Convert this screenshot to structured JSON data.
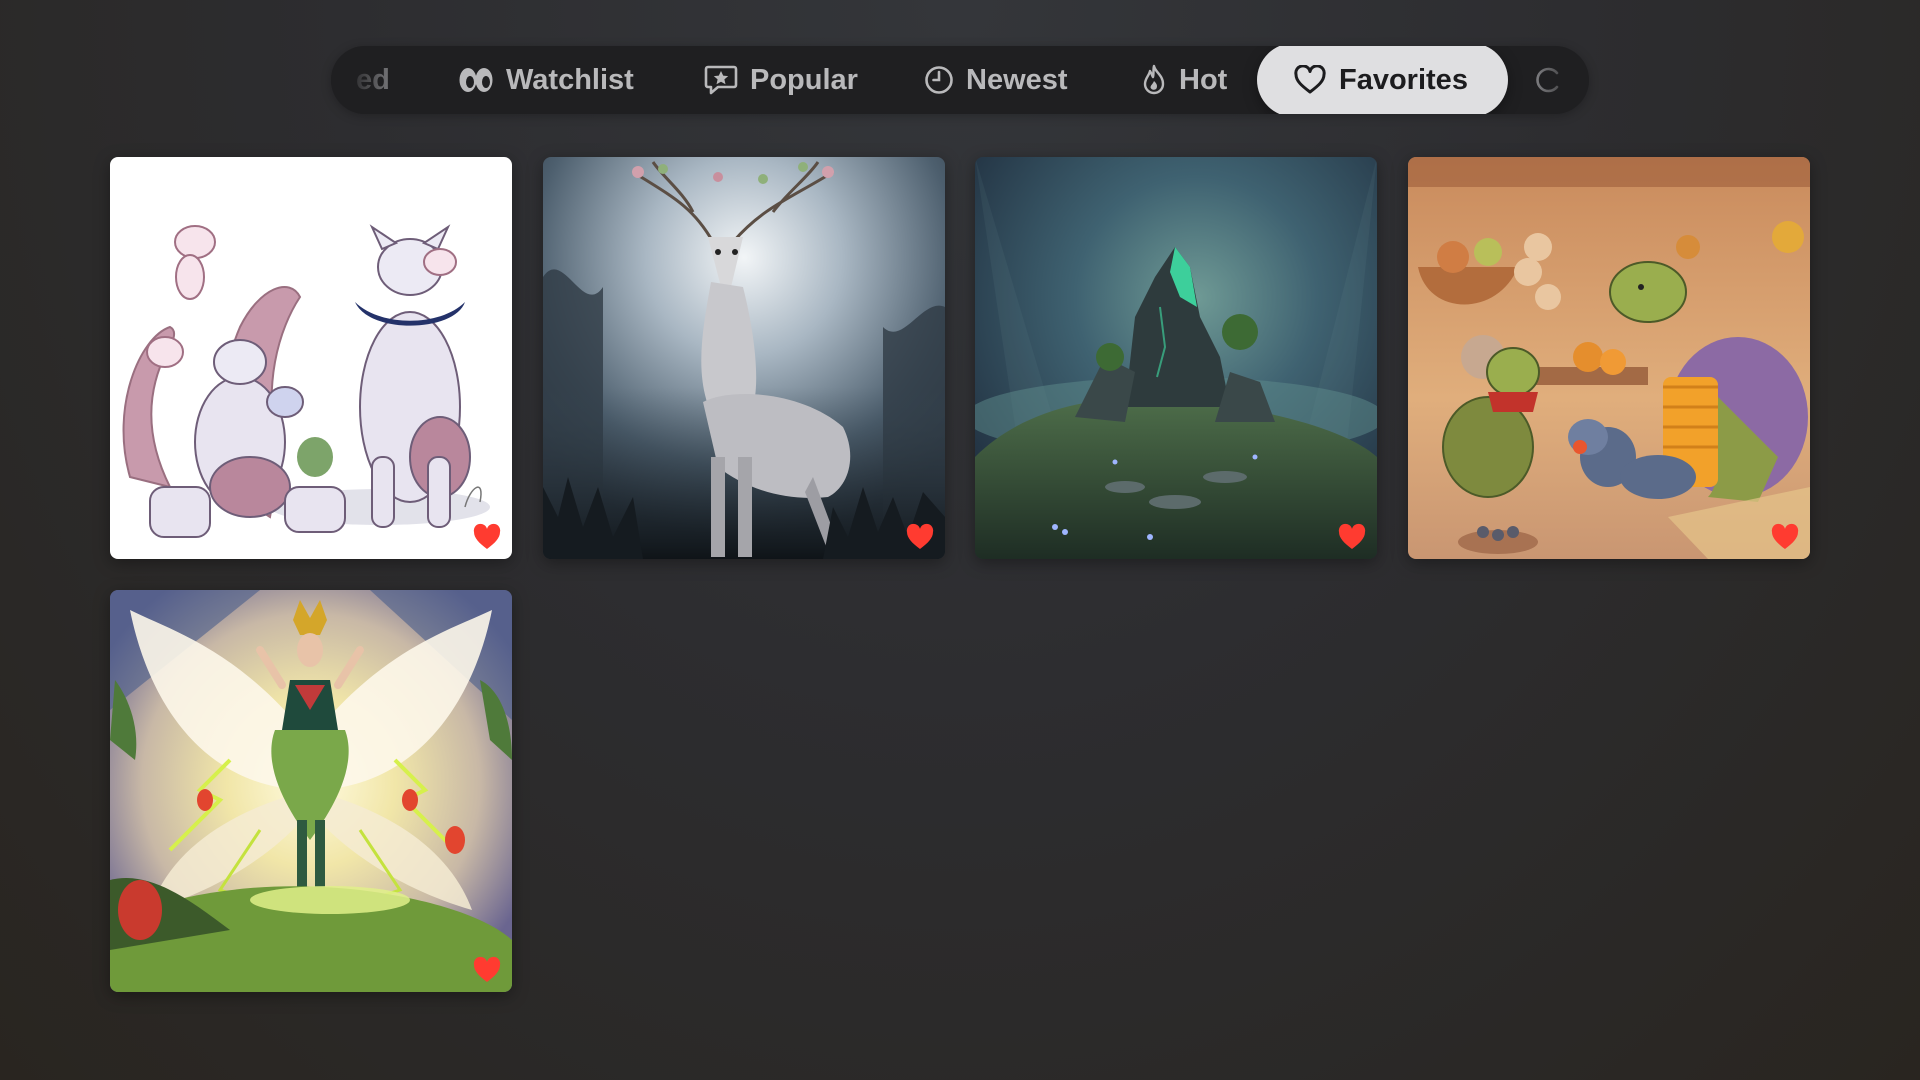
{
  "tabs": [
    {
      "label": "ed",
      "icon": "partial-tab",
      "active": false
    },
    {
      "label": "Watchlist",
      "icon": "eyes-icon",
      "active": false
    },
    {
      "label": "Popular",
      "icon": "star-bubble-icon",
      "active": false
    },
    {
      "label": "Newest",
      "icon": "clock-icon",
      "active": false
    },
    {
      "label": "Hot",
      "icon": "flame-icon",
      "active": false
    },
    {
      "label": "Favorites",
      "icon": "heart-outline-icon",
      "active": true
    },
    {
      "label": "",
      "icon": "partial-circle-icon",
      "active": false
    }
  ],
  "gallery": {
    "items": [
      {
        "name": "artwork-pokemon-mew-family",
        "favorited": true
      },
      {
        "name": "artwork-misty-forest-deer",
        "favorited": true
      },
      {
        "name": "artwork-crystal-rock-island",
        "favorited": true
      },
      {
        "name": "artwork-turtle-family-knitting",
        "favorited": true
      },
      {
        "name": "artwork-fairy-queen",
        "favorited": true
      }
    ]
  },
  "colors": {
    "accent_heart": "#ff3b30",
    "active_tab_bg": "#dfdfe1",
    "tabbar_bg": "#1f1f21"
  }
}
